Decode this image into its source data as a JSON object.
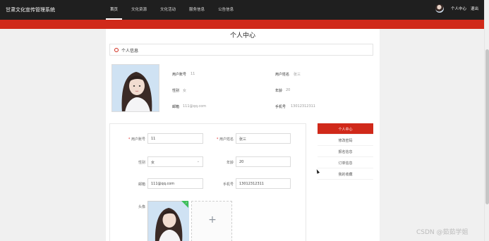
{
  "header": {
    "brand": "甘肃文化宣传管理系统",
    "nav": [
      "首页",
      "文化资源",
      "文化活动",
      "服务信息",
      "公告信息"
    ],
    "active_nav": 0,
    "user_center": "个人中心",
    "logout": "退出"
  },
  "page": {
    "title": "个人中心",
    "section": "个人信息"
  },
  "profile": {
    "account_label": "用户账号",
    "account": "11",
    "name_label": "用户姓名",
    "name": "张三",
    "gender_label": "性别",
    "gender": "女",
    "age_label": "年龄",
    "age": "20",
    "email_label": "邮箱",
    "email": "111@qq.com",
    "phone_label": "手机号",
    "phone": "13012312311"
  },
  "form": {
    "account_label": "用户账号",
    "account": "11",
    "name_label": "用户姓名",
    "name": "张三",
    "gender_label": "性别",
    "gender": "女",
    "age_label": "年龄",
    "age": "20",
    "email_label": "邮箱",
    "email": "111@qq.com",
    "phone_label": "手机号",
    "phone": "13012312311",
    "avatar_label": "头像",
    "required_mark": "*",
    "chevron": "⌄",
    "upload_plus": "+",
    "upload_check": "✓"
  },
  "side_menu": [
    "个人中心",
    "修改密码",
    "报名信息",
    "订单信息",
    "我的收藏"
  ],
  "side_menu_active": 0,
  "watermark": "CSDN @茹茹学姐",
  "colors": {
    "accent": "#d0291a",
    "topbar": "#1f1f1f"
  }
}
